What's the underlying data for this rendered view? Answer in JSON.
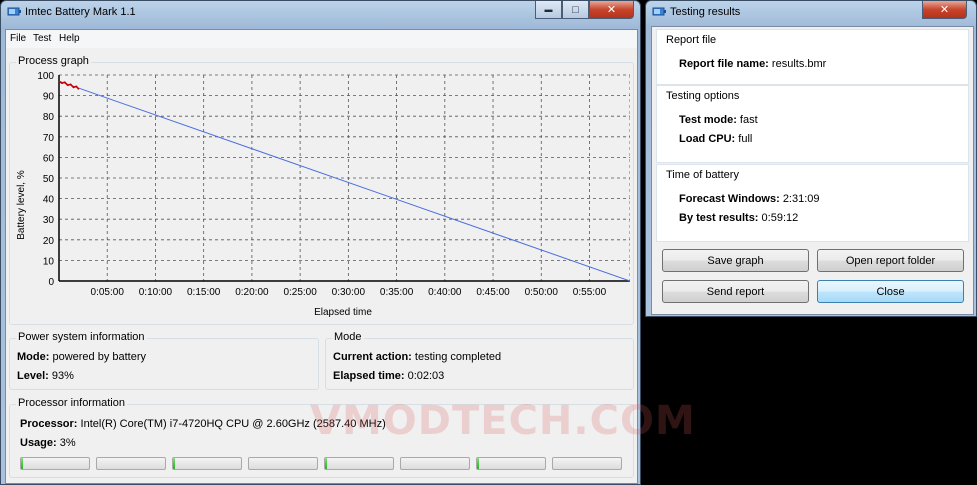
{
  "main_window": {
    "title": "Imtec Battery Mark 1.1",
    "minimize_glyph": "▬",
    "maximize_glyph": "□",
    "close_glyph": "✕",
    "menu": [
      "File",
      "Test",
      "Help"
    ],
    "process_graph": {
      "title": "Process graph",
      "ylabel": "Battery level, %",
      "xlabel": "Elapsed time"
    },
    "power": {
      "title": "Power system information",
      "mode_label": "Mode:",
      "mode_value": "powered by battery",
      "level_label": "Level:",
      "level_value": "93%"
    },
    "mode": {
      "title": "Mode",
      "action_label": "Current action:",
      "action_value": "testing completed",
      "elapsed_label": "Elapsed time:",
      "elapsed_value": "0:02:03"
    },
    "processor": {
      "title": "Processor information",
      "proc_label": "Processor:",
      "proc_value": "Intel(R) Core(TM) i7-4720HQ CPU @ 2.60GHz  (2587.40 MHz)",
      "usage_label": "Usage:",
      "usage_value": "3%",
      "core_loads": [
        0.02,
        0.0,
        0.02,
        0.0,
        0.02,
        0.0,
        0.02,
        0.0
      ]
    }
  },
  "results_window": {
    "title": "Testing results",
    "close_glyph": "✕",
    "report_file": {
      "title": "Report file",
      "name_label": "Report file name:",
      "name_value": "results.bmr"
    },
    "testing_options": {
      "title": "Testing options",
      "mode_label": "Test mode:",
      "mode_value": "fast",
      "cpu_label": "Load CPU:",
      "cpu_value": "full"
    },
    "time_of_battery": {
      "title": "Time of battery",
      "forecast_label": "Forecast Windows:",
      "forecast_value": "2:31:09",
      "bytest_label": "By test results:",
      "bytest_value": "0:59:12"
    },
    "buttons": {
      "save_graph": "Save graph",
      "open_folder": "Open report folder",
      "send_report": "Send report",
      "close": "Close"
    }
  },
  "watermark": "VMODTECH.COM",
  "chart_data": {
    "type": "line",
    "title": "Process graph",
    "xlabel": "Elapsed time",
    "ylabel": "Battery level, %",
    "xlim_minutes": [
      0,
      59.2
    ],
    "ylim": [
      0,
      100
    ],
    "x_ticks": [
      "0:05:00",
      "0:10:00",
      "0:15:00",
      "0:20:00",
      "0:25:00",
      "0:30:00",
      "0:35:00",
      "0:40:00",
      "0:45:00",
      "0:50:00",
      "0:55:00"
    ],
    "y_ticks": [
      0,
      10,
      20,
      30,
      40,
      50,
      60,
      70,
      80,
      90,
      100
    ],
    "grid": true,
    "series": [
      {
        "color": "#4a6fe0",
        "x": [
          0,
          59.2
        ],
        "y": [
          97,
          0
        ]
      },
      {
        "color": "#cc0000",
        "x": [
          0,
          0.3,
          0.6,
          0.9,
          1.2,
          1.5,
          1.8,
          2.05
        ],
        "y": [
          97,
          96,
          96.5,
          95,
          95.5,
          94,
          94.5,
          93
        ]
      }
    ]
  }
}
